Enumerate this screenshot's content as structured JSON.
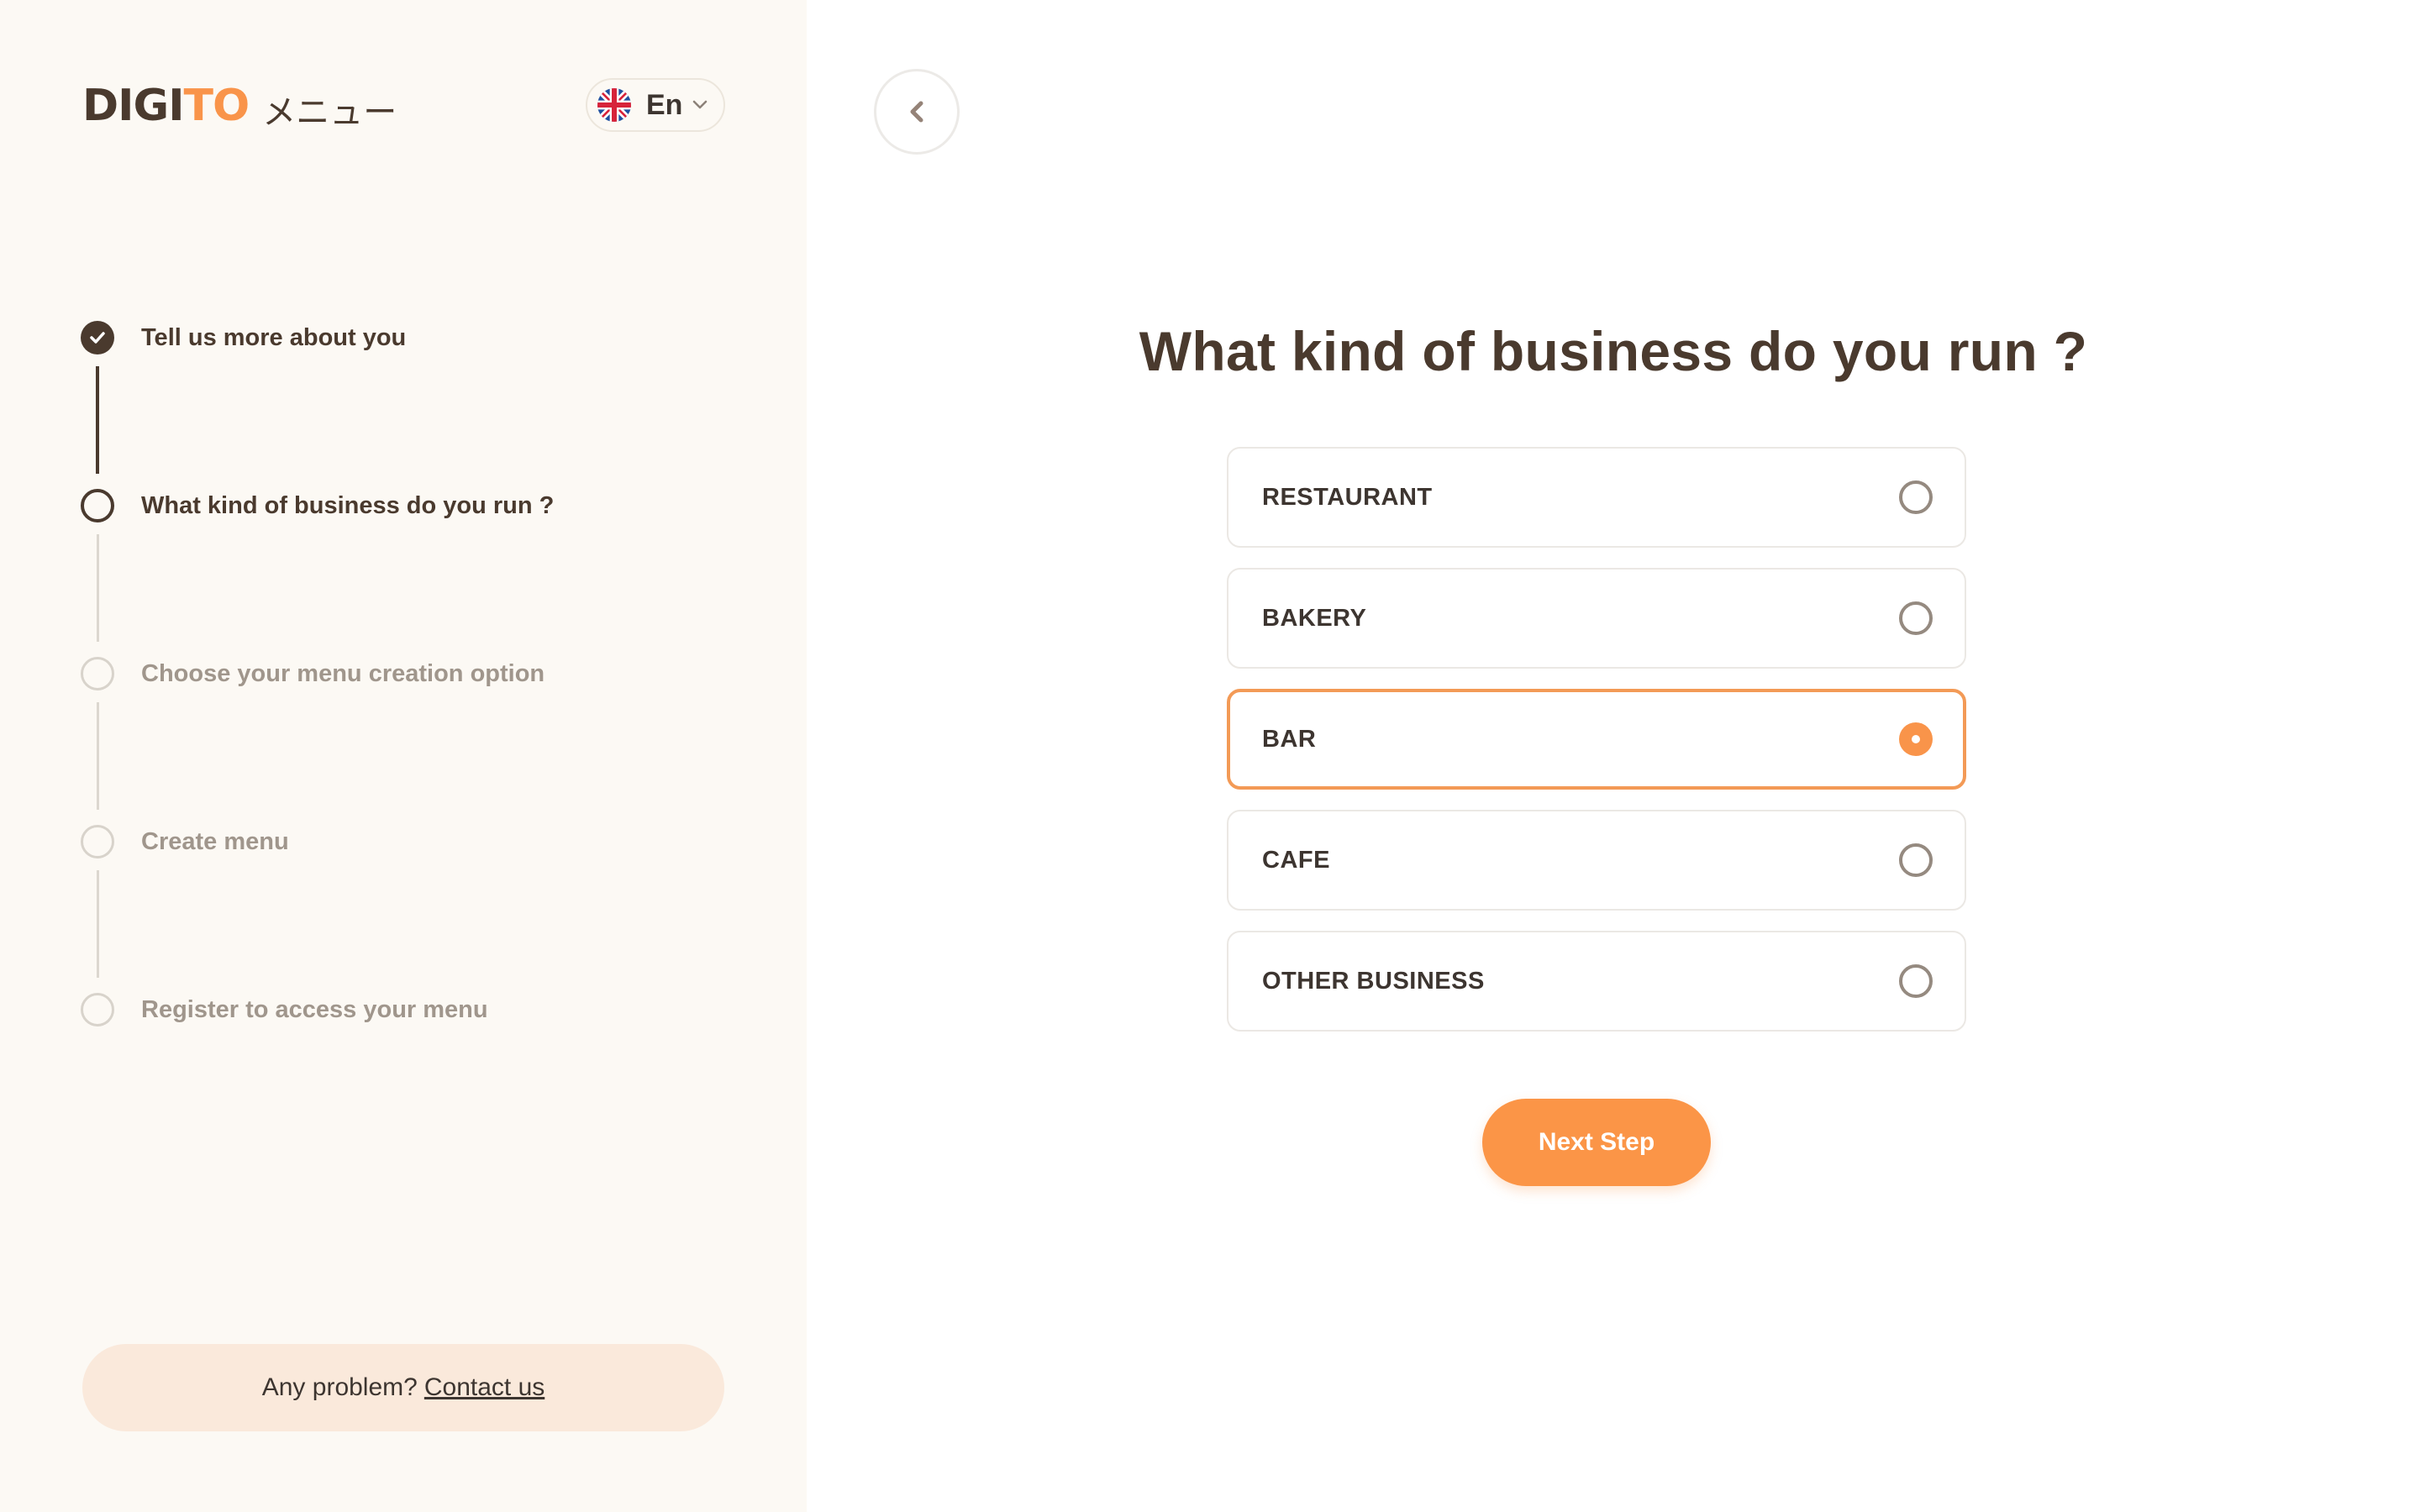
{
  "brand": {
    "name_part1": "DIGI",
    "name_part2": "TO",
    "name_suffix": "メニュー",
    "colors": {
      "dark": "#4a3a2e",
      "accent": "#f9944a"
    }
  },
  "language": {
    "selected": "En",
    "flag_icon": "uk-flag-icon",
    "dropdown_icon": "chevron-down-icon"
  },
  "steps": [
    {
      "label": "Tell us more about you",
      "status": "completed"
    },
    {
      "label": "What kind of business do you run ?",
      "status": "current"
    },
    {
      "label": "Choose your menu creation option",
      "status": "pending"
    },
    {
      "label": "Create menu",
      "status": "pending"
    },
    {
      "label": "Register to access your menu",
      "status": "pending"
    }
  ],
  "help": {
    "text": "Any problem?",
    "link_label": "Contact us"
  },
  "main": {
    "back_icon": "chevron-left-icon",
    "title": "What kind of business do you run ?",
    "options": [
      {
        "label": "RESTAURANT",
        "selected": false
      },
      {
        "label": "BAKERY",
        "selected": false
      },
      {
        "label": "BAR",
        "selected": true
      },
      {
        "label": "CAFE",
        "selected": false
      },
      {
        "label": "OTHER BUSINESS",
        "selected": false
      }
    ],
    "next_button_label": "Next Step"
  }
}
